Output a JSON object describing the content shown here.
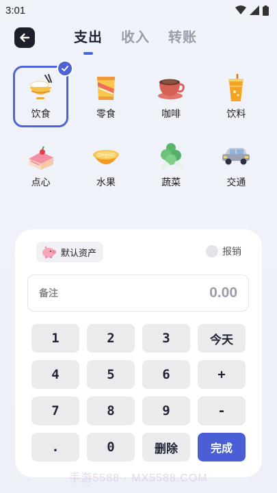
{
  "status_bar": {
    "time": "3:01"
  },
  "header": {
    "tabs": [
      {
        "label": "支出",
        "active": true
      },
      {
        "label": "收入",
        "active": false
      },
      {
        "label": "转账",
        "active": false
      }
    ]
  },
  "categories": [
    {
      "label": "饮食",
      "icon": "rice-bowl-icon",
      "selected": true
    },
    {
      "label": "零食",
      "icon": "snack-bag-icon",
      "selected": false
    },
    {
      "label": "咖啡",
      "icon": "coffee-cup-icon",
      "selected": false
    },
    {
      "label": "饮料",
      "icon": "drink-cup-icon",
      "selected": false
    },
    {
      "label": "点心",
      "icon": "cake-icon",
      "selected": false
    },
    {
      "label": "水果",
      "icon": "orange-icon",
      "selected": false
    },
    {
      "label": "蔬菜",
      "icon": "vegetable-icon",
      "selected": false
    },
    {
      "label": "交通",
      "icon": "car-icon",
      "selected": false
    }
  ],
  "panel": {
    "asset_label": "默认资产",
    "reimburse_label": "报销",
    "note_label": "备注",
    "amount": "0.00"
  },
  "keypad": [
    [
      "1",
      "2",
      "3",
      "今天"
    ],
    [
      "4",
      "5",
      "6",
      "+"
    ],
    [
      "7",
      "8",
      "9",
      "-"
    ],
    [
      ".",
      "0",
      "删除",
      "完成"
    ]
  ],
  "watermark": "手游5588 · MX5588.COM",
  "colors": {
    "accent": "#4a5fd6",
    "background": "#eef0f8",
    "key": "#ebebee"
  }
}
